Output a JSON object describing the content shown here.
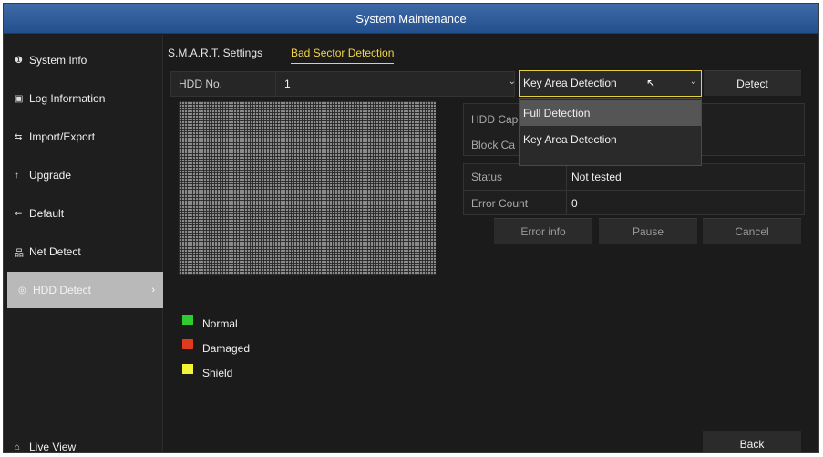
{
  "window": {
    "title": "System Maintenance"
  },
  "sidebar": {
    "items": [
      {
        "label": "System Info",
        "icon": "info-icon",
        "glyph": "❶"
      },
      {
        "label": "Log Information",
        "icon": "log-icon",
        "glyph": "▣"
      },
      {
        "label": "Import/Export",
        "icon": "import-export-icon",
        "glyph": "⇆"
      },
      {
        "label": "Upgrade",
        "icon": "upgrade-icon",
        "glyph": "↑"
      },
      {
        "label": "Default",
        "icon": "default-icon",
        "glyph": "⇐"
      },
      {
        "label": "Net Detect",
        "icon": "network-icon",
        "glyph": "品"
      },
      {
        "label": "HDD Detect",
        "icon": "hdd-icon",
        "glyph": "◎",
        "active": true,
        "chevron": "›"
      }
    ],
    "live_view": {
      "label": "Live View",
      "icon": "home-icon",
      "glyph": "⌂"
    }
  },
  "tabs": [
    {
      "label": "S.M.A.R.T. Settings",
      "active": false
    },
    {
      "label": "Bad Sector Detection",
      "active": true
    }
  ],
  "hdd": {
    "label": "HDD No.",
    "value": "1",
    "caret": "⌄"
  },
  "detection_mode": {
    "selected": "Key Area Detection",
    "caret": "⌄",
    "cursor": "↖",
    "options": [
      "Full Detection",
      "Key Area Detection"
    ]
  },
  "buttons": {
    "detect": "Detect",
    "error_info": "Error info",
    "pause": "Pause",
    "cancel": "Cancel",
    "back": "Back"
  },
  "capacity": {
    "hdd_capacity_label": "HDD Cap",
    "block_capacity_label": "Block Ca"
  },
  "status": {
    "status_label": "Status",
    "status_value": "Not tested",
    "error_count_label": "Error Count",
    "error_count_value": "0"
  },
  "legend": [
    {
      "label": "Normal",
      "color": "#2ecc2e"
    },
    {
      "label": "Damaged",
      "color": "#e03a1e"
    },
    {
      "label": "Shield",
      "color": "#f5f23a"
    }
  ],
  "colors": {
    "accent": "#f3d34a",
    "titlebar": "#2f5c99"
  }
}
